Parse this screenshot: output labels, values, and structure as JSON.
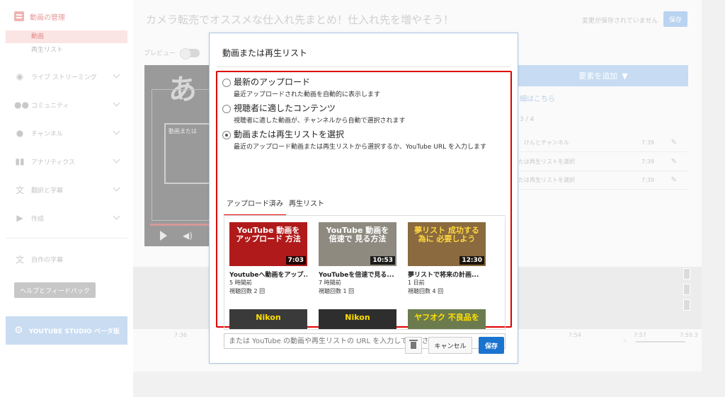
{
  "sidebar": {
    "header": "動画の管理",
    "sub_items": [
      "動画",
      "再生リスト"
    ],
    "items": [
      {
        "label": "ライブ ストリーミング",
        "icon": "live-icon"
      },
      {
        "label": "コミュニティ",
        "icon": "community-icon"
      },
      {
        "label": "チャンネル",
        "icon": "channel-icon"
      },
      {
        "label": "アナリティクス",
        "icon": "analytics-icon"
      },
      {
        "label": "翻訳と字幕",
        "icon": "translate-icon"
      },
      {
        "label": "作成",
        "icon": "create-icon"
      }
    ],
    "my_subtitles": "自作の字幕",
    "help": "ヘルプとフィードバック",
    "studio": "YOUTUBE STUDIO ベータ版"
  },
  "main": {
    "title": "カメラ転売でオススメな仕入れ先まとめ！仕入れ先を増やそう！",
    "unsaved": "変更が保存されていません",
    "save": "保存",
    "preview": "プレビュー",
    "video_big_char": "あ",
    "video_label": "動画または",
    "add_element": "要素を追加",
    "detail_link": "細はこちら",
    "count": "3 / 4",
    "element_rows": [
      {
        "text": "けんとチャンネル",
        "time": "7:39"
      },
      {
        "text": "たは再生リストを選択",
        "time": "7:39"
      },
      {
        "text": "たは再生リストを選択",
        "time": "7:39"
      }
    ],
    "timeline_ticks": [
      {
        "label": "7:36"
      },
      {
        "label": "7:54"
      },
      {
        "label": "7:57"
      },
      {
        "label": "7:59.3"
      }
    ]
  },
  "modal": {
    "title": "動画または再生リスト",
    "options": [
      {
        "title": "最新のアップロード",
        "desc": "最近アップロードされた動画を自動的に表示します",
        "checked": false
      },
      {
        "title": "視聴者に適したコンテンツ",
        "desc": "視聴者に適した動画が、チャンネルから自動で選択されます",
        "checked": false
      },
      {
        "title": "動画または再生リストを選択",
        "desc": "最近のアップロード動画または再生リストから選択するか、YouTube URL を入力します",
        "checked": true
      }
    ],
    "tabs": [
      "アップロード済み",
      "再生リスト"
    ],
    "videos": [
      {
        "thumb_text": "YouTube 動画を アップロード 方法",
        "duration": "7:03",
        "title": "Youtubeへ動画をアップ...",
        "age": "5 時間前",
        "views": "視聴回数 2 回",
        "bg": "#b11a1a"
      },
      {
        "thumb_text": "YouTube 動画を 倍速で 見る方法",
        "duration": "10:53",
        "title": "YouTubeを倍速で見る...",
        "age": "7 時間前",
        "views": "視聴回数 1 回",
        "bg": "#8e8a80"
      },
      {
        "thumb_text": "夢リスト 成功する為に 必要しよう",
        "duration": "12:30",
        "title": "夢リストで将来の計画...",
        "age": "1 日前",
        "views": "視聴回数 4 回",
        "bg": "#8a6a3e"
      },
      {
        "thumb_text": "Nikon",
        "duration": "",
        "title": "",
        "age": "",
        "views": "",
        "bg": "#3a3a3a"
      },
      {
        "thumb_text": "Nikon",
        "duration": "",
        "title": "",
        "age": "",
        "views": "",
        "bg": "#2e2e2e"
      },
      {
        "thumb_text": "ヤフオク 不良品を",
        "duration": "",
        "title": "",
        "age": "",
        "views": "",
        "bg": "#6c7b4e"
      }
    ],
    "url_placeholder": "または YouTube の動画や再生リストの URL を入力してください",
    "cancel": "キャンセル",
    "save": "保存"
  }
}
